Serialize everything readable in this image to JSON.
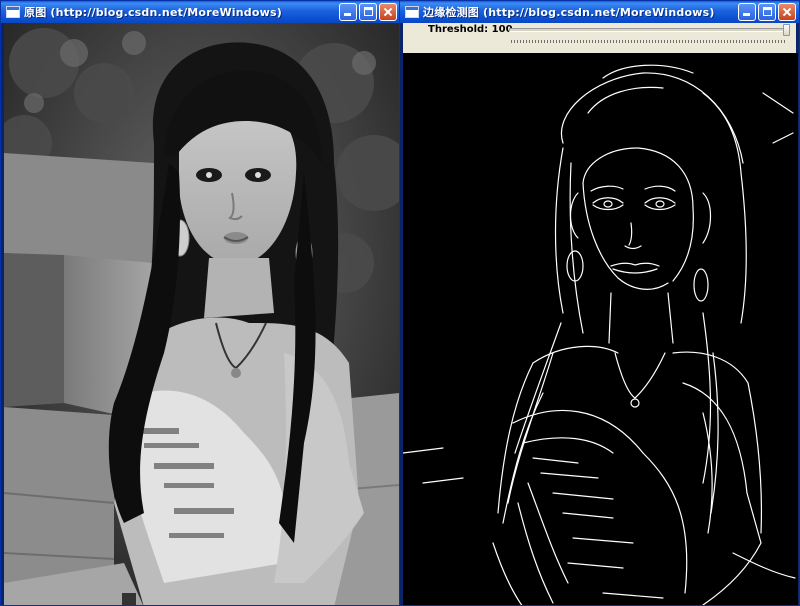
{
  "left_window": {
    "title": "原图 (http://blog.csdn.net/MoreWindows)",
    "icon": "window-icon",
    "buttons": [
      "minimize",
      "maximize",
      "close"
    ]
  },
  "right_window": {
    "title": "边缘检测图 (http://blog.csdn.net/MoreWindows)",
    "icon": "window-icon",
    "buttons": [
      "minimize",
      "maximize",
      "close"
    ],
    "trackbar": {
      "label": "Threshold: 100",
      "value": 100,
      "max": 100
    }
  },
  "colors": {
    "titlebar": "#0a5fe0",
    "close_button": "#c7421f",
    "edge_stroke": "#ffffff",
    "edge_background": "#000000"
  }
}
